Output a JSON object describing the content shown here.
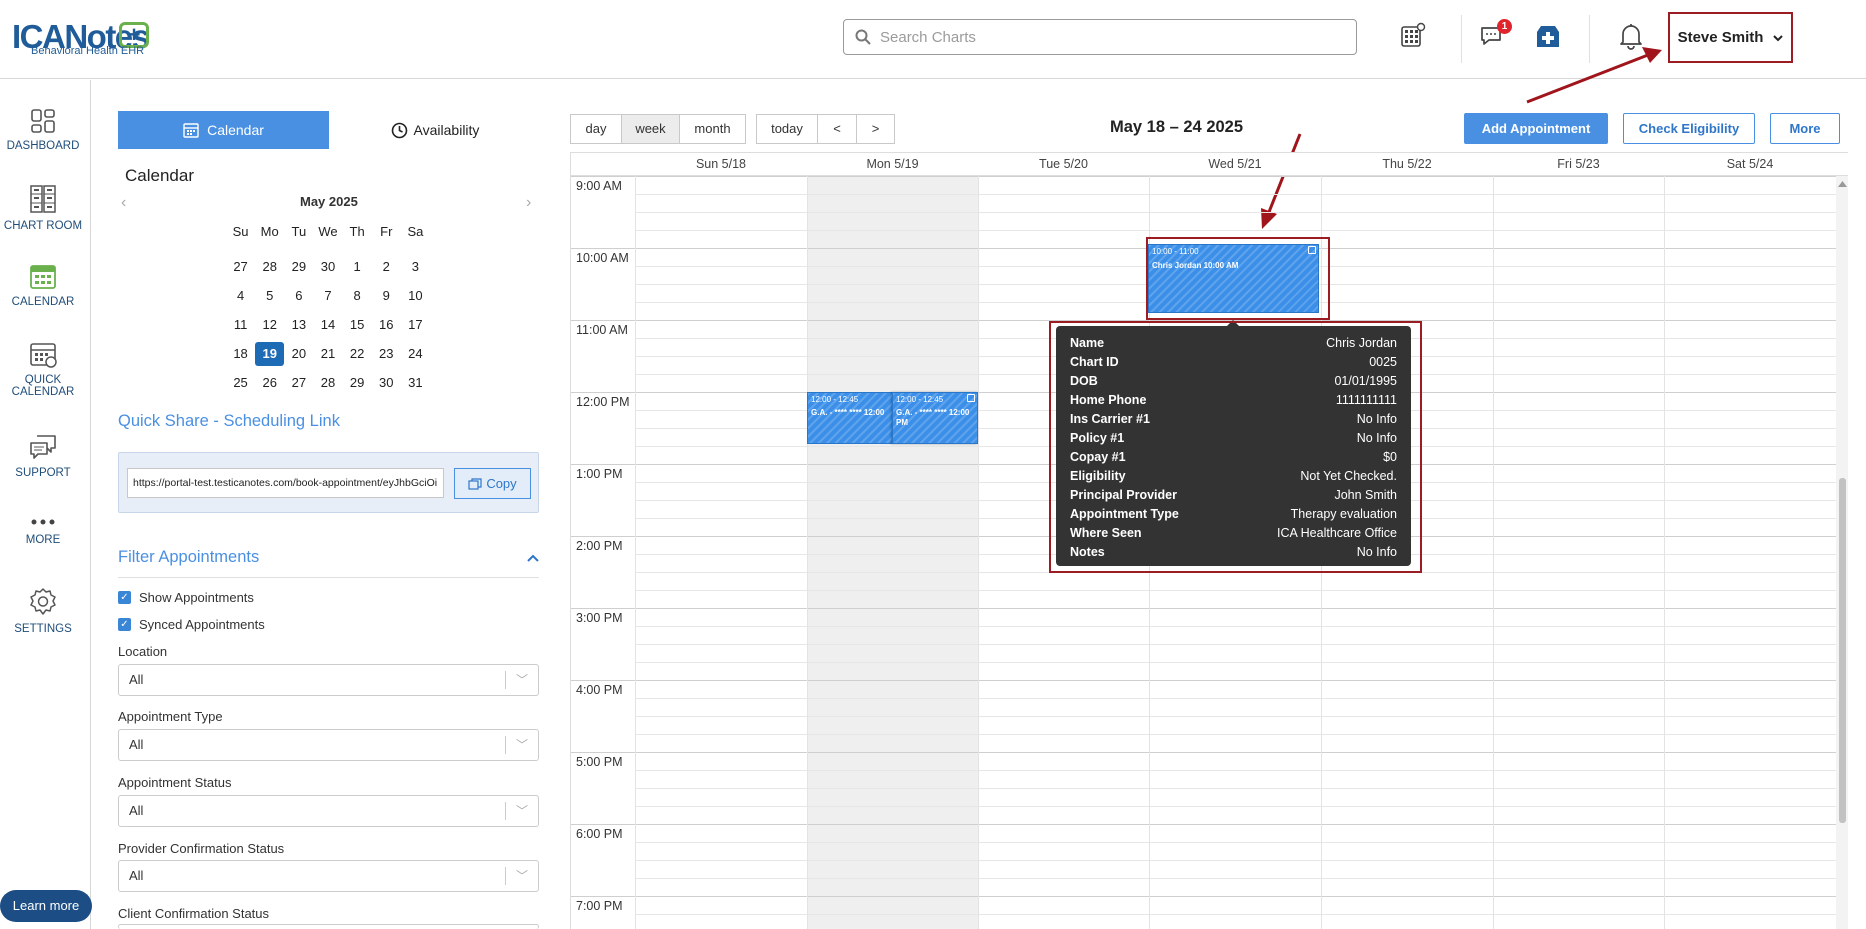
{
  "app": {
    "logo_text": "ICANotes",
    "logo_plus": "+",
    "logo_sub": "Behavioral Health EHR"
  },
  "header": {
    "search_placeholder": "Search Charts",
    "message_count": "1",
    "user_name": "Steve Smith",
    "icons": [
      "calculator-grid-icon",
      "chat-icon",
      "building-plus-icon",
      "bell-icon",
      "chevron-down-icon"
    ]
  },
  "nav": [
    {
      "label": "DASHBOARD",
      "icon": "dashboard-icon"
    },
    {
      "label": "CHART ROOM",
      "icon": "file-cabinet-icon"
    },
    {
      "label": "CALENDAR",
      "icon": "calendar-icon",
      "active": true
    },
    {
      "label": "QUICK",
      "label2": "CALENDAR",
      "icon": "quick-calendar-icon"
    },
    {
      "label": "SUPPORT",
      "icon": "support-chat-icon"
    },
    {
      "label": "MORE",
      "icon": "more-dots-icon"
    },
    {
      "label": "SETTINGS",
      "icon": "gear-icon"
    }
  ],
  "learn_more": "Learn more",
  "left_panel": {
    "tab_calendar": "Calendar",
    "tab_availability": "Availability",
    "title": "Calendar",
    "mini_cal": {
      "month": "May 2025",
      "weekdays": [
        "Su",
        "Mo",
        "Tu",
        "We",
        "Th",
        "Fr",
        "Sa"
      ],
      "weeks": [
        [
          "27",
          "28",
          "29",
          "30",
          "1",
          "2",
          "3"
        ],
        [
          "4",
          "5",
          "6",
          "7",
          "8",
          "9",
          "10"
        ],
        [
          "11",
          "12",
          "13",
          "14",
          "15",
          "16",
          "17"
        ],
        [
          "18",
          "19",
          "20",
          "21",
          "22",
          "23",
          "24"
        ],
        [
          "25",
          "26",
          "27",
          "28",
          "29",
          "30",
          "31"
        ]
      ],
      "selected": "19"
    },
    "quick_share_title": "Quick Share - Scheduling Link",
    "share_url": "https://portal-test.testicanotes.com/book-appointment/eyJhbGciOi",
    "copy_label": "Copy",
    "filter_title": "Filter Appointments",
    "checkboxes": [
      {
        "label": "Show Appointments",
        "checked": true
      },
      {
        "label": "Synced Appointments",
        "checked": true
      }
    ],
    "filters": [
      {
        "label": "Location",
        "value": "All"
      },
      {
        "label": "Appointment Type",
        "value": "All"
      },
      {
        "label": "Appointment Status",
        "value": "All"
      },
      {
        "label": "Provider Confirmation Status",
        "value": "All"
      },
      {
        "label": "Client Confirmation Status",
        "value": ""
      }
    ]
  },
  "toolbar": {
    "views": [
      "day",
      "week",
      "month"
    ],
    "active_view": "week",
    "today": "today",
    "prev": "<",
    "next": ">",
    "range_title": "May 18 – 24 2025",
    "add_appointment": "Add Appointment",
    "check_eligibility": "Check Eligibility",
    "more": "More"
  },
  "calendar": {
    "days": [
      "Sun 5/18",
      "Mon 5/19",
      "Tue 5/20",
      "Wed 5/21",
      "Thu 5/22",
      "Fri 5/23",
      "Sat 5/24"
    ],
    "times": [
      "9:00 AM",
      "10:00 AM",
      "11:00 AM",
      "12:00 PM",
      "1:00 PM",
      "2:00 PM",
      "3:00 PM",
      "4:00 PM",
      "5:00 PM",
      "6:00 PM",
      "7:00 PM"
    ],
    "appointments": [
      {
        "time": "10:00 - 11:00",
        "title": "Chris Jordan 10:00 AM"
      },
      {
        "time": "12:00 - 12:45",
        "title": "G.A. - **** **** 12:00"
      },
      {
        "time": "12:00 - 12:45",
        "title": "G.A. - **** **** 12:00 PM"
      }
    ]
  },
  "tooltip": {
    "rows": [
      {
        "k": "Name",
        "v": "Chris Jordan"
      },
      {
        "k": "Chart ID",
        "v": "0025"
      },
      {
        "k": "DOB",
        "v": "01/01/1995"
      },
      {
        "k": "Home Phone",
        "v": "1111111111"
      },
      {
        "k": "Ins Carrier #1",
        "v": "No Info"
      },
      {
        "k": "Policy #1",
        "v": "No Info"
      },
      {
        "k": "Copay #1",
        "v": "$0"
      },
      {
        "k": "Eligibility",
        "v": "Not Yet Checked."
      },
      {
        "k": "Principal Provider",
        "v": "John Smith"
      },
      {
        "k": "Appointment Type",
        "v": "Therapy evaluation"
      },
      {
        "k": "Where Seen",
        "v": "ICA Healthcare Office"
      },
      {
        "k": "Notes",
        "v": "No Info"
      }
    ]
  },
  "colors": {
    "primary": "#4a90e2",
    "brand": "#1f5c99",
    "highlight": "#9b1c22",
    "appointment": "#3b8fe8",
    "tooltip_bg": "#333333"
  }
}
